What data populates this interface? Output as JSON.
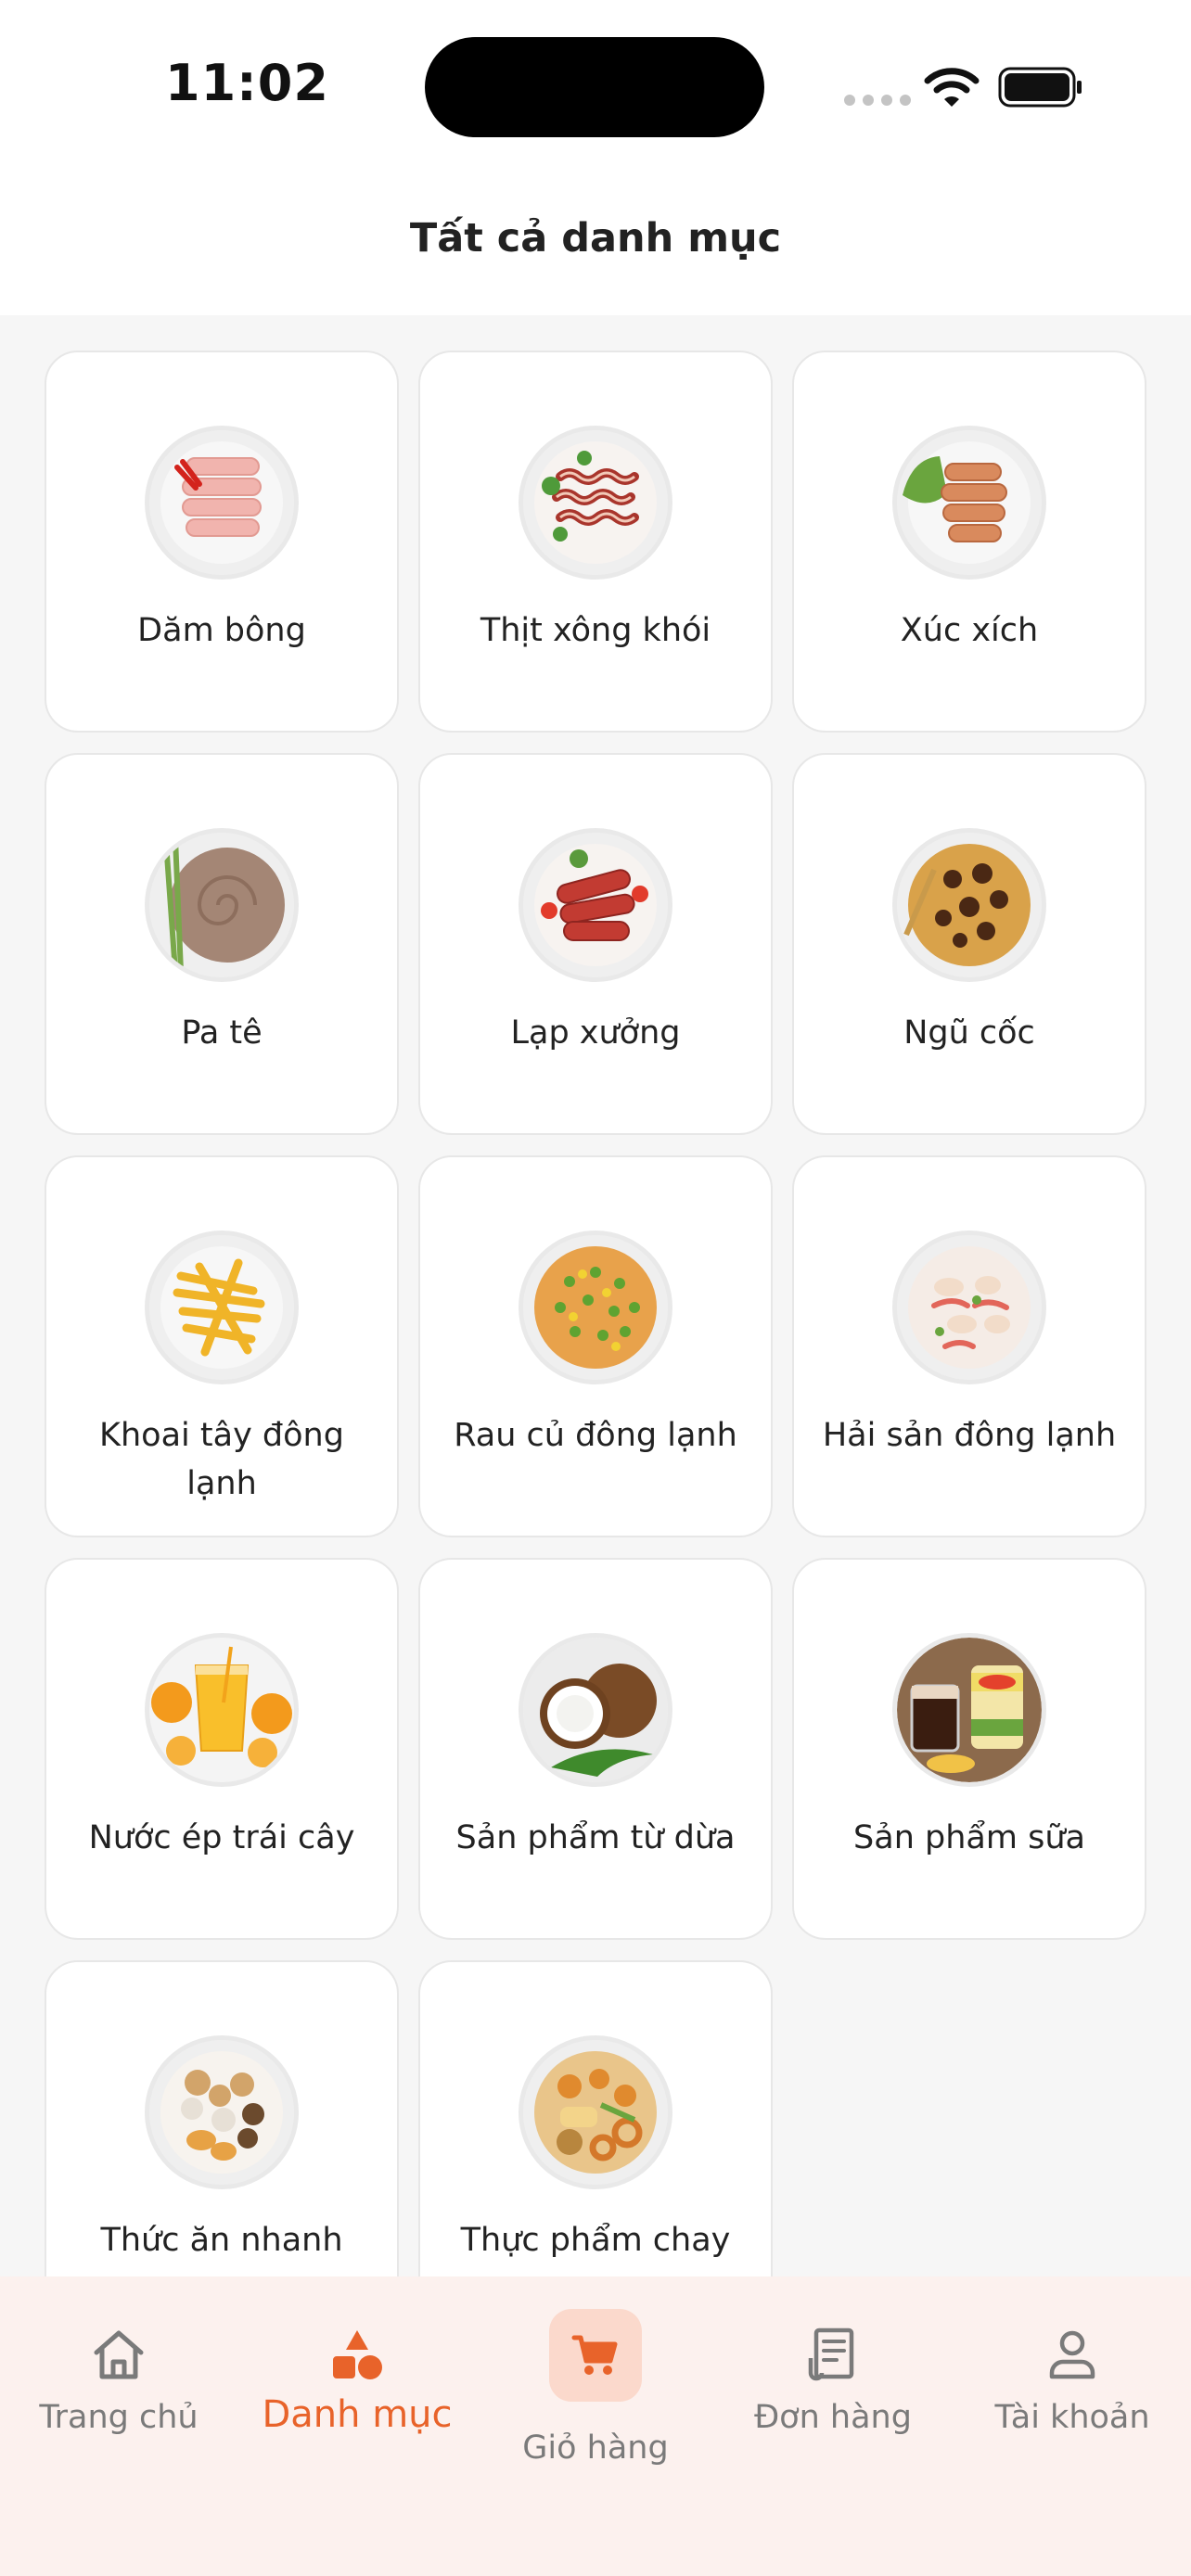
{
  "status": {
    "time": "11:02"
  },
  "header": {
    "title": "Tất cả danh mục"
  },
  "categories": [
    {
      "name": "Dăm bông",
      "icon": "ham-slices-image"
    },
    {
      "name": "Thịt xông khói",
      "icon": "bacon-image"
    },
    {
      "name": "Xúc xích",
      "icon": "sausage-image"
    },
    {
      "name": "Pa tê",
      "icon": "pate-image"
    },
    {
      "name": "Lạp xưởng",
      "icon": "chinese-sausage-image"
    },
    {
      "name": "Ngũ cốc",
      "icon": "cereal-image"
    },
    {
      "name": "Khoai tây đông lạnh",
      "icon": "french-fries-image"
    },
    {
      "name": "Rau củ đông lạnh",
      "icon": "mixed-vegetables-image"
    },
    {
      "name": "Hải sản đông lạnh",
      "icon": "seafood-image"
    },
    {
      "name": "Nước ép trái cây",
      "icon": "orange-juice-image"
    },
    {
      "name": "Sản phẩm từ dừa",
      "icon": "coconut-image"
    },
    {
      "name": "Sản phẩm sữa",
      "icon": "milk-product-image"
    },
    {
      "name": "Thức ăn nhanh",
      "icon": "fast-food-image"
    },
    {
      "name": "Thực phẩm chay",
      "icon": "vegetarian-food-image"
    }
  ],
  "tabbar": {
    "home": "Trang chủ",
    "category": "Danh mục",
    "cart": "Giỏ hàng",
    "orders": "Đơn hàng",
    "account": "Tài khoản"
  },
  "colors": {
    "accent": "#e8632a",
    "tabbar_bg": "#fcf1ee",
    "page_bg": "#f6f6f6"
  }
}
